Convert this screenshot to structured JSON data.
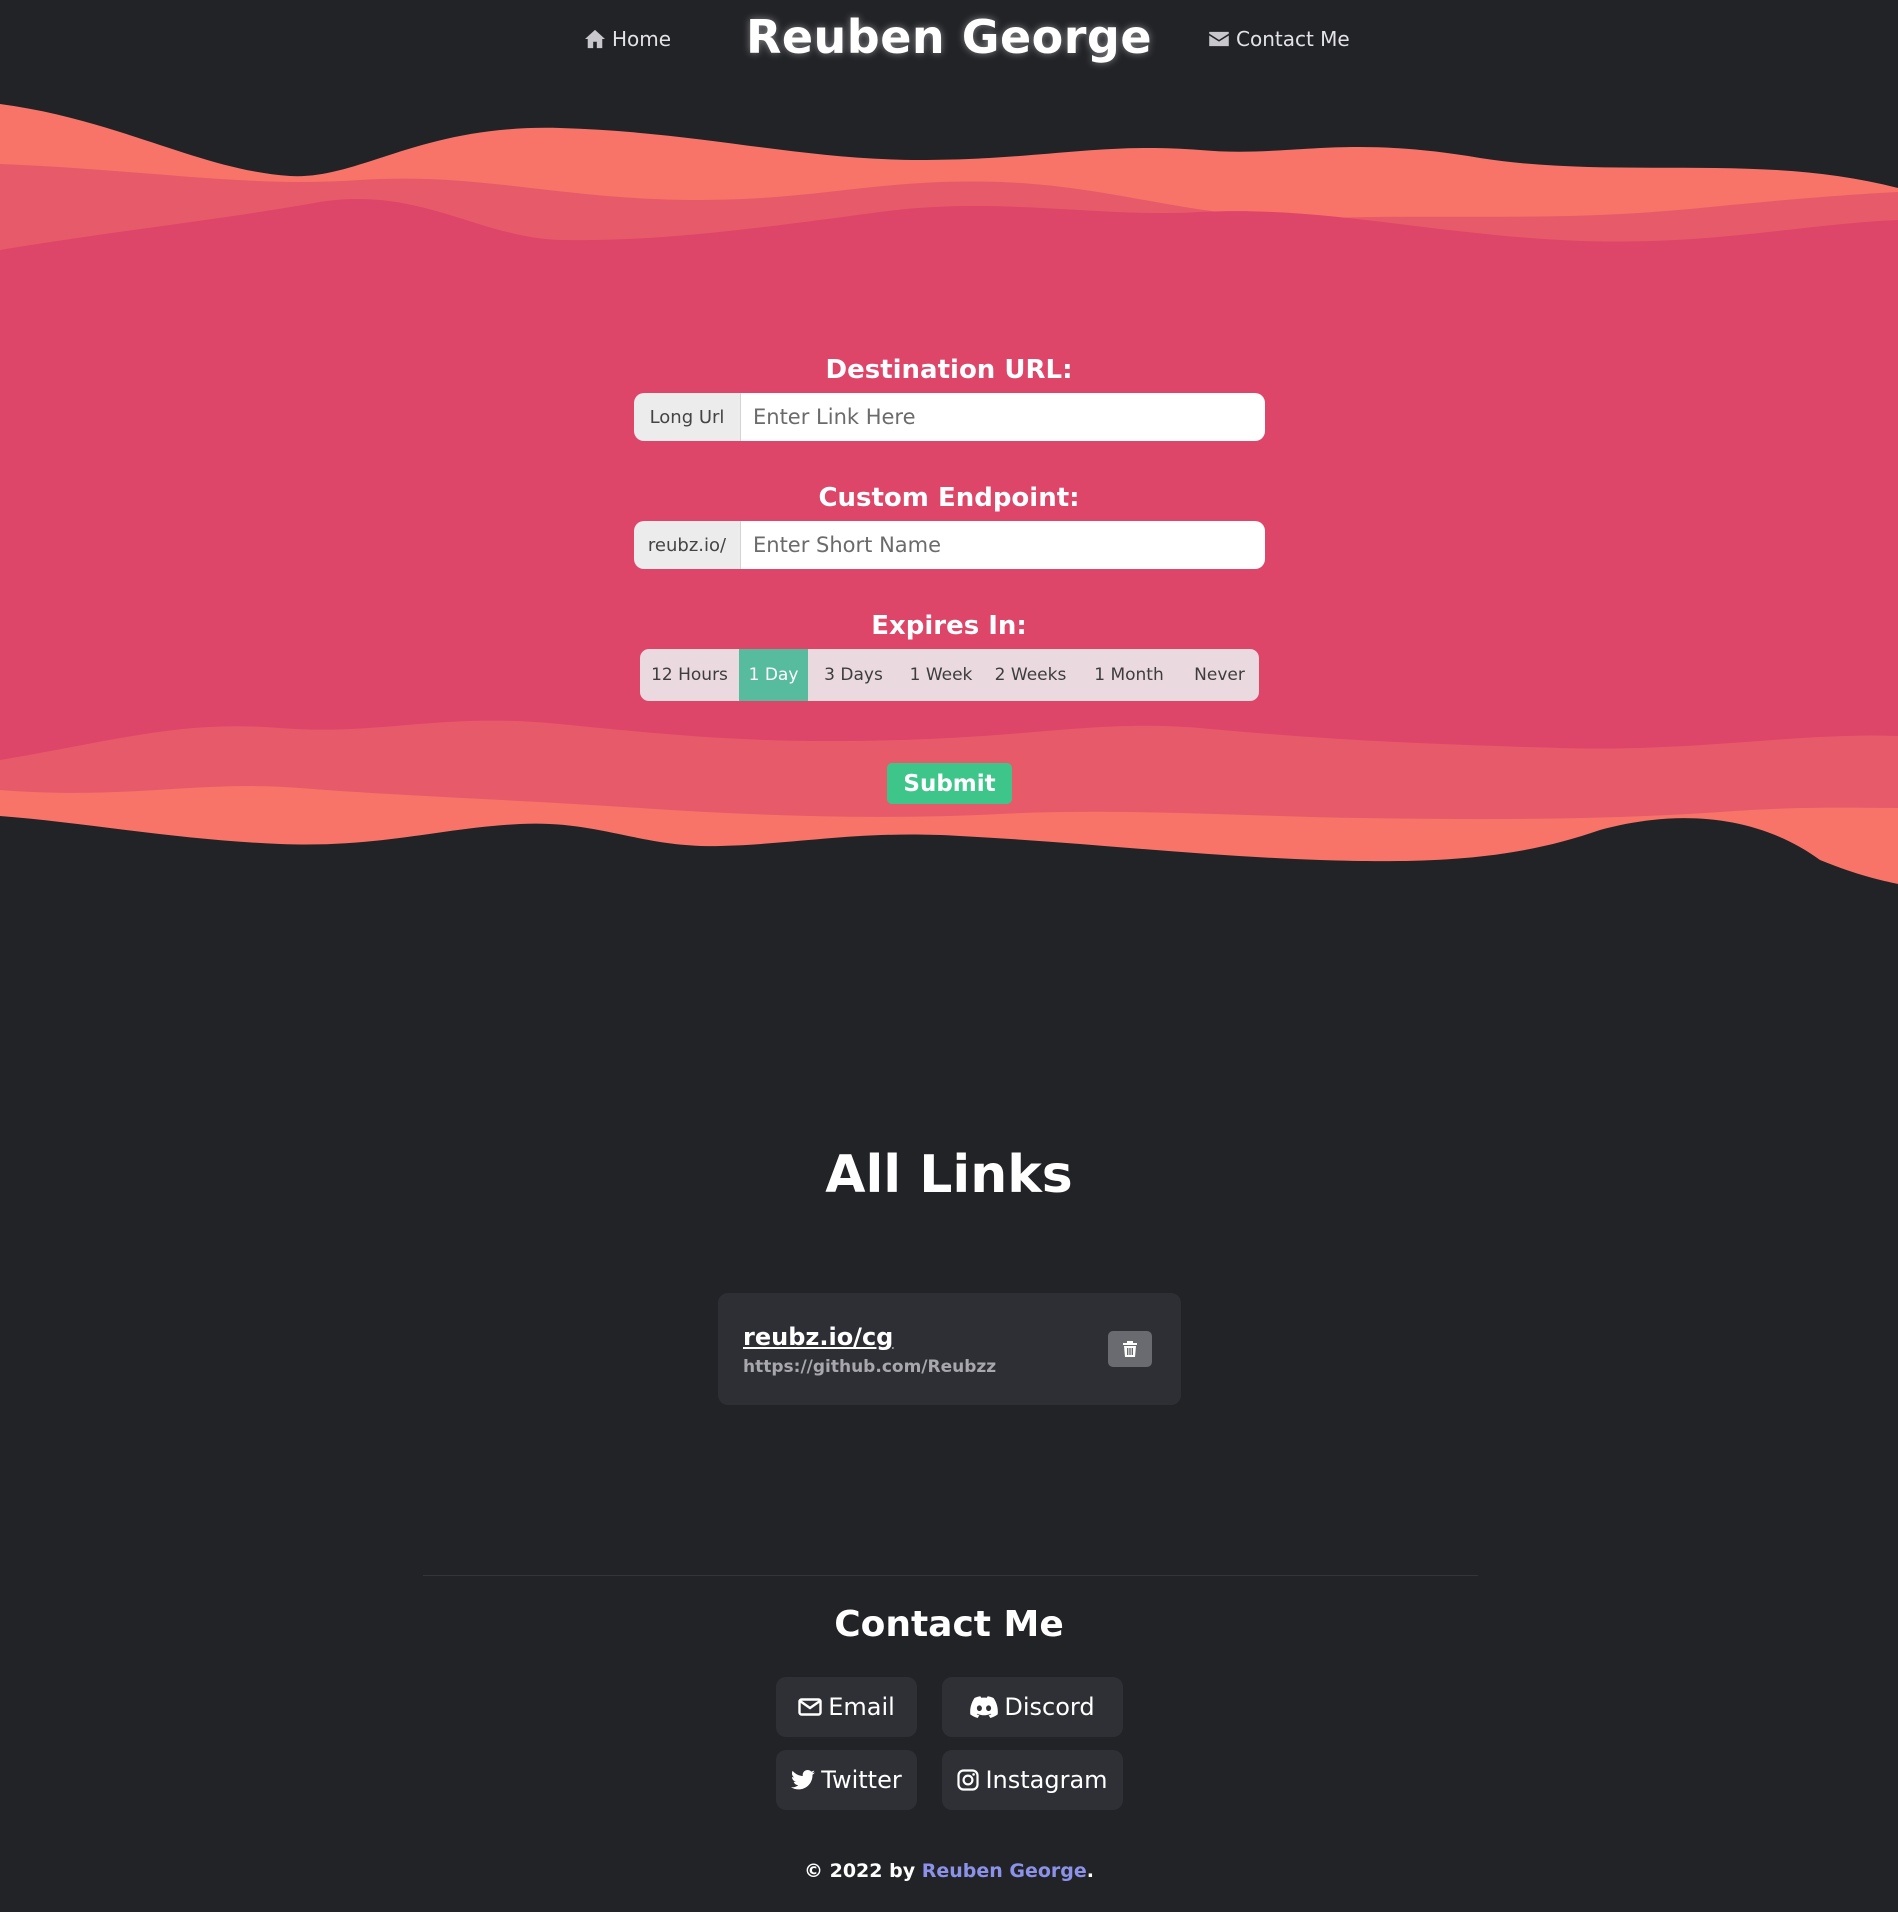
{
  "nav": {
    "home_label": "Home",
    "brand": "Reuben George",
    "contact_label": "Contact Me"
  },
  "form": {
    "destination": {
      "label": "Destination URL:",
      "addon": "Long Url",
      "placeholder": "Enter Link Here",
      "value": ""
    },
    "endpoint": {
      "label": "Custom Endpoint:",
      "addon": "reubz.io/",
      "placeholder": "Enter Short Name",
      "value": ""
    },
    "expires": {
      "label": "Expires In:",
      "options": [
        "12 Hours",
        "1 Day",
        "3 Days",
        "1 Week",
        "2 Weeks",
        "1 Month",
        "Never"
      ],
      "selected": "1 Day"
    },
    "submit_label": "Submit"
  },
  "links": {
    "title": "All Links",
    "items": [
      {
        "short": "reubz.io/cg",
        "long": "https://github.com/Reubzz"
      }
    ]
  },
  "contact": {
    "title": "Contact Me",
    "buttons": {
      "email": "Email",
      "discord": "Discord",
      "twitter": "Twitter",
      "instagram": "Instagram"
    }
  },
  "footer": {
    "prefix": "© 2022 by",
    "name": "Reuben George",
    "suffix": "."
  },
  "colors": {
    "background": "#222327",
    "wave_light": "#f87468",
    "wave_mid": "#e65a6a",
    "wave_main": "#dd4569",
    "accent_green": "#3ec68a",
    "selected_option": "#57bb9d",
    "link_accent": "#8b92e8"
  },
  "icons": [
    "home-icon",
    "envelope-icon",
    "trash-icon",
    "discord-icon",
    "twitter-icon",
    "instagram-icon"
  ]
}
